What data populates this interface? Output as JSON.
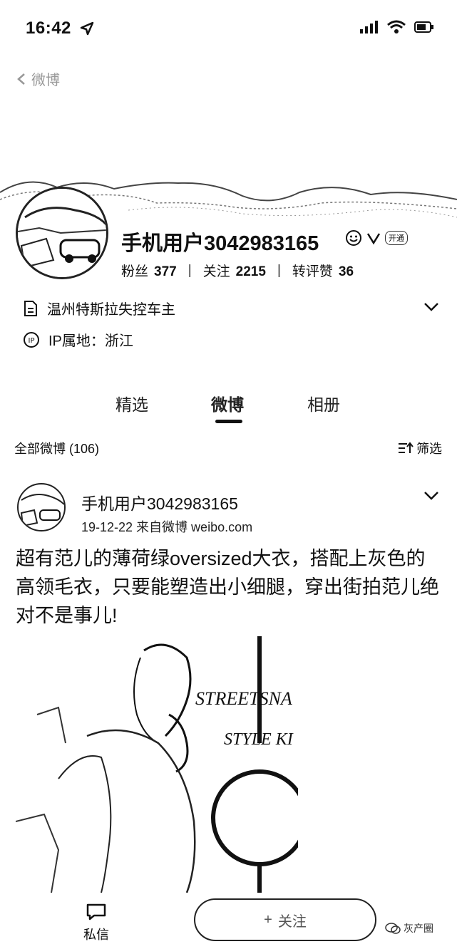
{
  "status_bar": {
    "time": "16:42"
  },
  "nav": {
    "back_text": "微博"
  },
  "profile": {
    "name": "手机用户3042983165",
    "badge_text": "开通",
    "fans_label": "粉丝",
    "fans": "377",
    "following_label": "关注",
    "following": "2215",
    "likes_label": "转评赞",
    "likes": "36",
    "bio": "温州特斯拉失控车主",
    "ip": "IP属地：浙江"
  },
  "tabs": [
    "精选",
    "微博",
    "相册"
  ],
  "filter": {
    "all_posts": "全部微博 (106)",
    "filter_label": "筛选"
  },
  "post": {
    "author": "手机用户3042983165",
    "date_source": "19-12-22  来自微博 weibo.com",
    "text": "超有范儿的薄荷绿oversized大衣，搭配上灰色的高领毛衣，只要能塑造出小细腿，穿出街拍范儿绝对不是事儿!",
    "image_text_1": "STREETSNA",
    "image_text_2": "STYLE KI"
  },
  "bottom": {
    "dm_label": "私信",
    "follow_label": "关注",
    "watermark": "灰产圈"
  }
}
